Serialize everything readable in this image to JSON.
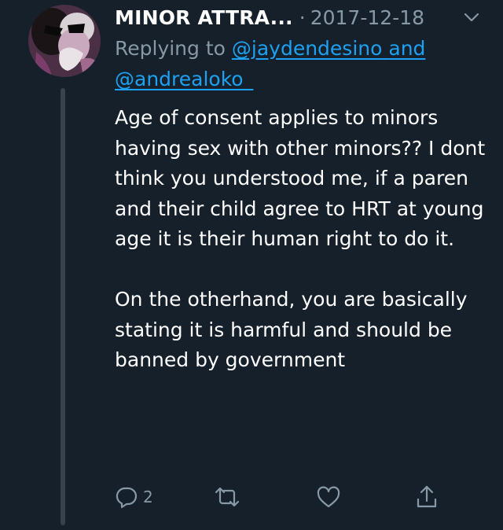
{
  "tweet": {
    "display_name": "MINOR ATTRA...",
    "separator": "·",
    "date": "2017-12-18",
    "replying_prefix": "Replying to",
    "mention_1": "@jaydendesino",
    "mention_joiner": "and",
    "mention_2": "@andrealoko_",
    "body": "Age of consent applies to minors having sex with other minors?? I dont think you understood me, if a paren and their child agree to HRT at young age it is their human right to do it.\n\nOn the otherhand, you are basically stating it is harmful and should be banned by government"
  },
  "actions": {
    "reply_count": "2",
    "icons": [
      "reply-icon",
      "retweet-icon",
      "like-icon",
      "share-icon"
    ]
  },
  "colors": {
    "background": "#15202b",
    "text": "#ffffff",
    "secondary": "#8899a6",
    "link": "#1da1f2",
    "thread_line": "#38444d"
  }
}
